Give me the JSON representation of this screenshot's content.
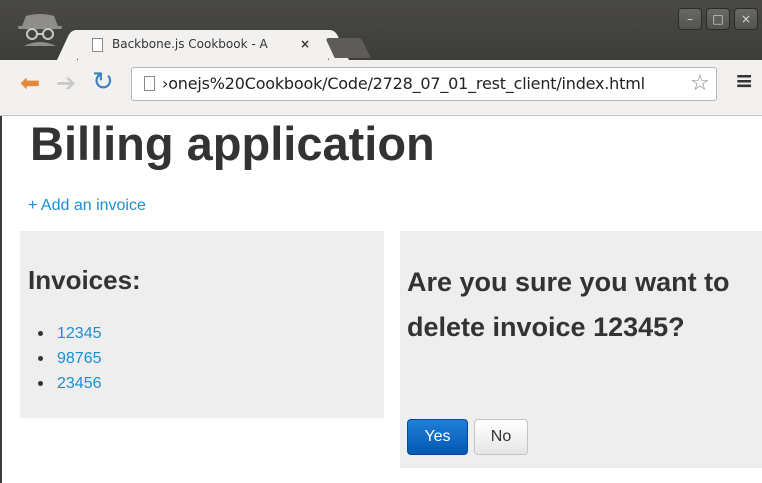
{
  "browser": {
    "tab_title": "Backbone.js Cookbook - A",
    "tab_close": "×",
    "url": "›onejs%20Cookbook/Code/2728_07_01_rest_client/index.html",
    "window_buttons": [
      "–",
      "□",
      "×"
    ],
    "icons": {
      "back": "back-arrow-icon",
      "forward": "forward-arrow-icon",
      "reload": "reload-icon",
      "bookmark": "star-icon",
      "menu": "menu-icon",
      "profile": "incognito-icon"
    }
  },
  "page": {
    "title": "Billing application",
    "add_link": "+ Add an invoice",
    "invoices_heading": "Invoices:",
    "invoices": [
      "12345",
      "98765",
      "23456"
    ],
    "confirm_heading": "Are you sure you want to delete invoice 12345?",
    "yes_label": "Yes",
    "no_label": "No"
  },
  "colors": {
    "link": "#1a8fd1",
    "panel_bg": "#eeeeee",
    "primary_button": "#0558b3",
    "heading_text": "#333333"
  }
}
